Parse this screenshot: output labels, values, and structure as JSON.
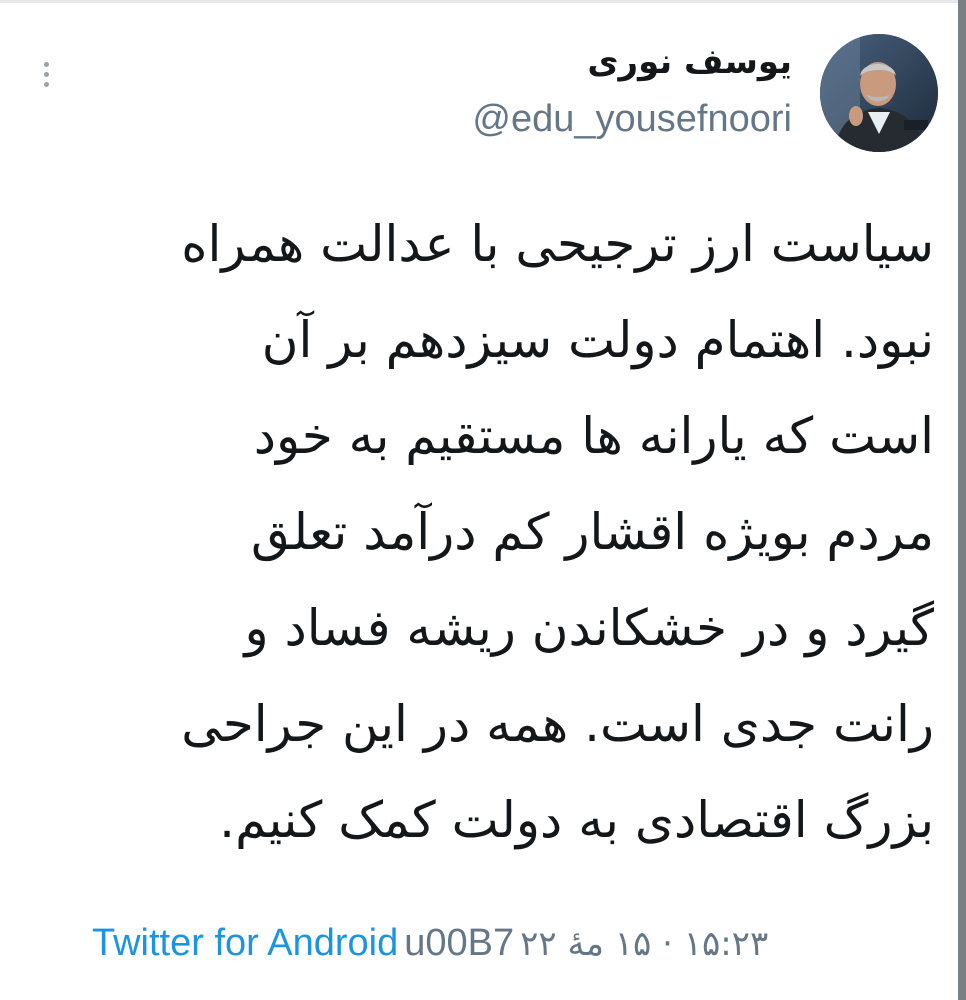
{
  "tweet": {
    "author": {
      "display_name": "یوسف نوری",
      "handle": "@edu_yousefnoori",
      "avatar_icon": "profile-photo"
    },
    "body_lines": [
      "سیاست ارز ترجیحی با عدالت همراه",
      "نبود. اهتمام دولت سیزدهم بر آن",
      "است که یارانه ها مستقیم به خود",
      "مردم بویژه اقشار کم درآمد تعلق",
      "گیرد و در خشکاندن ریشه فساد و",
      "رانت جدی است. همه در این جراحی",
      "بزرگ اقتصادی به دولت کمک کنیم."
    ],
    "source": "Twitter for Android",
    "separator": "u00B7",
    "timestamp": "۱۵:۲۳ · ۱۵ مهٔ ۲۲"
  },
  "menu": {
    "icon": "more-vertical-icon"
  },
  "colors": {
    "text": "#14171a",
    "secondary": "#657786",
    "link": "#1b95e0",
    "background": "#ffffff"
  }
}
